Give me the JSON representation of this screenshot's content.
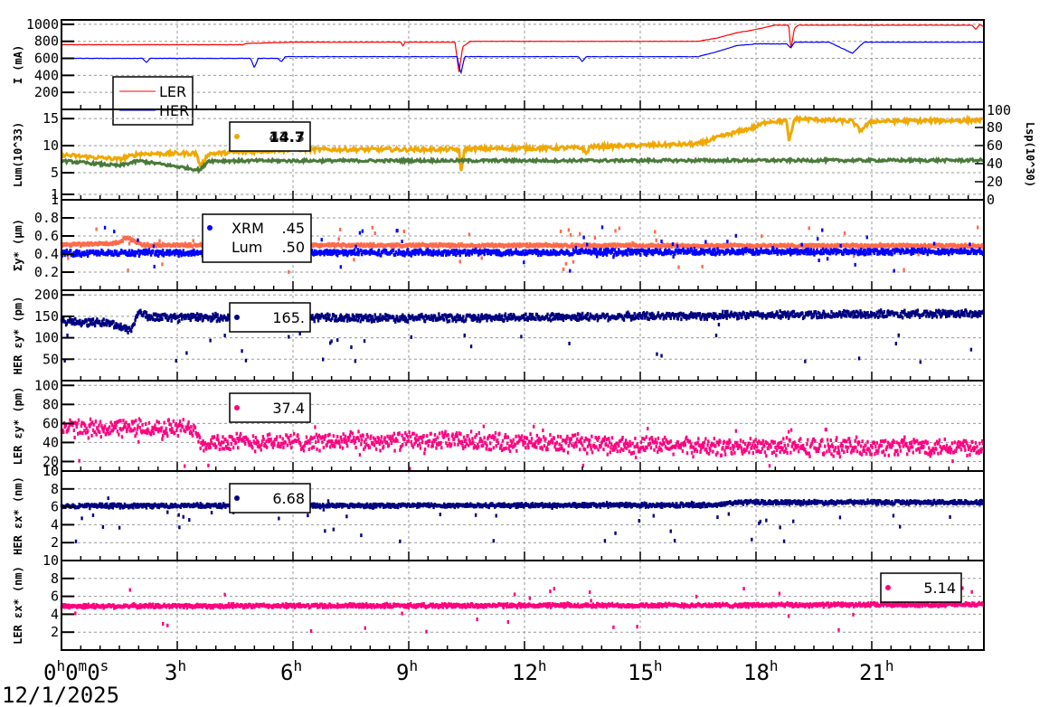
{
  "chart_data": [
    {
      "type": "line",
      "ylabel": "I (mA)",
      "ylim": [
        0,
        1052
      ],
      "yticks": [
        200,
        400,
        600,
        800,
        1000
      ],
      "legend_labels": [
        "LER",
        "HER"
      ],
      "series": [
        {
          "name": "LER",
          "color": "#ff0000",
          "noise": 2,
          "anchors": [
            [
              0,
              760
            ],
            [
              4.7,
              760
            ],
            [
              4.8,
              775
            ],
            [
              6,
              790
            ],
            [
              8.8,
              790
            ],
            [
              8.85,
              740
            ],
            [
              8.9,
              790
            ],
            [
              10.2,
              790
            ],
            [
              10.3,
              430
            ],
            [
              10.4,
              740
            ],
            [
              10.6,
              800
            ],
            [
              16.5,
              800
            ],
            [
              17,
              840
            ],
            [
              17.5,
              900
            ],
            [
              18,
              940
            ],
            [
              18.5,
              990
            ],
            [
              18.85,
              990
            ],
            [
              18.9,
              700
            ],
            [
              19,
              960
            ],
            [
              19.1,
              990
            ],
            [
              23.6,
              990
            ],
            [
              23.7,
              940
            ],
            [
              23.8,
              1000
            ],
            [
              23.9,
              970
            ]
          ]
        },
        {
          "name": "HER",
          "color": "#0000ff",
          "noise": 2,
          "anchors": [
            [
              0,
              600
            ],
            [
              2.1,
              600
            ],
            [
              2.2,
              550
            ],
            [
              2.3,
              600
            ],
            [
              4.9,
              600
            ],
            [
              5,
              490
            ],
            [
              5.1,
              600
            ],
            [
              5.6,
              600
            ],
            [
              5.7,
              560
            ],
            [
              5.8,
              620
            ],
            [
              10.25,
              620
            ],
            [
              10.35,
              420
            ],
            [
              10.45,
              620
            ],
            [
              13.4,
              620
            ],
            [
              13.5,
              560
            ],
            [
              13.6,
              620
            ],
            [
              16.5,
              620
            ],
            [
              17,
              680
            ],
            [
              17.5,
              750
            ],
            [
              18,
              770
            ],
            [
              18.8,
              770
            ],
            [
              18.9,
              720
            ],
            [
              19,
              790
            ],
            [
              19.9,
              790
            ],
            [
              20.5,
              660
            ],
            [
              20.8,
              790
            ],
            [
              23.9,
              790
            ]
          ]
        }
      ]
    },
    {
      "type": "line",
      "ylabel": "Lum(10^33)",
      "ylim": [
        0,
        16.7
      ],
      "yticks": [
        1,
        5,
        10,
        15
      ],
      "y2label": "Lsp(10^30)",
      "y2lim": [
        0,
        100
      ],
      "y2ticks": [
        0,
        20,
        40,
        60,
        80,
        100
      ],
      "legend_values": [
        "14.7",
        "43.3"
      ],
      "series": [
        {
          "name": "Lum",
          "color": "#f0a800",
          "noise": 0.35,
          "anchors": [
            [
              0,
              8.3
            ],
            [
              1.5,
              7.5
            ],
            [
              2,
              8.5
            ],
            [
              3.5,
              8.6
            ],
            [
              3.6,
              6
            ],
            [
              3.8,
              8.5
            ],
            [
              6,
              9.3
            ],
            [
              10.3,
              9.3
            ],
            [
              10.35,
              5
            ],
            [
              10.45,
              9.4
            ],
            [
              13.5,
              9.6
            ],
            [
              13.6,
              8.5
            ],
            [
              13.7,
              9.8
            ],
            [
              16.5,
              10.3
            ],
            [
              17,
              11.5
            ],
            [
              18,
              13.5
            ],
            [
              18.3,
              14.5
            ],
            [
              18.8,
              14.5
            ],
            [
              18.85,
              10.5
            ],
            [
              19,
              15
            ],
            [
              20.5,
              14.5
            ],
            [
              20.7,
              12.8
            ],
            [
              21,
              14.5
            ],
            [
              23.9,
              14.7
            ]
          ]
        },
        {
          "name": "Lsp",
          "color": "#4a7a3a",
          "noise": 0.25,
          "anchors": [
            [
              0,
              7.2
            ],
            [
              1.5,
              6.3
            ],
            [
              2,
              7.2
            ],
            [
              3.6,
              5.5
            ],
            [
              3.8,
              7.2
            ],
            [
              23.9,
              7.3
            ]
          ]
        }
      ]
    },
    {
      "type": "scatter",
      "ylabel": "Σy* (μm)",
      "ylim": [
        0,
        1
      ],
      "yticks": [
        0.2,
        0.4,
        0.6,
        0.8,
        1
      ],
      "legend_labels": [
        "XRM",
        ".45",
        "Lum",
        ".50"
      ],
      "series": [
        {
          "name": "Lum",
          "color": "#ff6a4a",
          "noise": 0.015,
          "anchors": [
            [
              0,
              0.5
            ],
            [
              1.4,
              0.52
            ],
            [
              1.7,
              0.58
            ],
            [
              2.1,
              0.5
            ],
            [
              23.9,
              0.49
            ]
          ]
        },
        {
          "name": "XRM",
          "color": "#0000ff",
          "noise": 0.03,
          "anchors": [
            [
              0,
              0.41
            ],
            [
              23.9,
              0.43
            ]
          ]
        }
      ]
    },
    {
      "type": "scatter",
      "ylabel": "HER εy* (pm)",
      "ylim": [
        0,
        211
      ],
      "yticks": [
        50,
        100,
        150,
        200
      ],
      "legend_values": [
        "165."
      ],
      "series": [
        {
          "name": "HER",
          "color": "#000080",
          "noise": 8,
          "anchors": [
            [
              0,
              138
            ],
            [
              1.2,
              135
            ],
            [
              1.8,
              118
            ],
            [
              2,
              160
            ],
            [
              2.3,
              148
            ],
            [
              10,
              146
            ],
            [
              17,
              152
            ],
            [
              23.9,
              157
            ]
          ]
        }
      ]
    },
    {
      "type": "scatter",
      "ylabel": "LER εy* (pm)",
      "ylim": [
        10,
        105
      ],
      "yticks": [
        10,
        20,
        40,
        60,
        80,
        100
      ],
      "legend_values": [
        "37.4"
      ],
      "series": [
        {
          "name": "LER",
          "color": "#ff0080",
          "noise": 9,
          "anchors": [
            [
              0,
              55
            ],
            [
              3.5,
              55
            ],
            [
              3.6,
              40
            ],
            [
              10.3,
              42
            ],
            [
              12,
              40
            ],
            [
              17,
              35
            ],
            [
              23.9,
              36
            ]
          ]
        }
      ]
    },
    {
      "type": "scatter",
      "ylabel": "HER εx* (nm)",
      "ylim": [
        0,
        10
      ],
      "yticks": [
        2,
        4,
        6,
        8,
        10
      ],
      "legend_values": [
        "6.68"
      ],
      "series": [
        {
          "name": "HER",
          "color": "#000080",
          "noise": 0.2,
          "anchors": [
            [
              0,
              6.1
            ],
            [
              17,
              6.2
            ],
            [
              17.5,
              6.5
            ],
            [
              23.9,
              6.5
            ]
          ]
        }
      ]
    },
    {
      "type": "scatter",
      "ylabel": "LER εx* (nm)",
      "ylim": [
        0,
        10
      ],
      "yticks": [
        2,
        4,
        6,
        8,
        10
      ],
      "legend_values": [
        "5.14"
      ],
      "series": [
        {
          "name": "LER",
          "color": "#ff0080",
          "noise": 0.2,
          "anchors": [
            [
              0,
              4.9
            ],
            [
              17,
              5.0
            ],
            [
              23.9,
              5.1
            ]
          ]
        }
      ]
    }
  ],
  "x_axis": {
    "xlim_hours": [
      0,
      23.9
    ],
    "ticks": [
      {
        "h": 0,
        "base": "0",
        "sup": "h",
        "extra": "0m0s"
      },
      {
        "h": 3,
        "base": "3",
        "sup": "h"
      },
      {
        "h": 6,
        "base": "6",
        "sup": "h"
      },
      {
        "h": 9,
        "base": "9",
        "sup": "h"
      },
      {
        "h": 12,
        "base": "12",
        "sup": "h"
      },
      {
        "h": 15,
        "base": "15",
        "sup": "h"
      },
      {
        "h": 18,
        "base": "18",
        "sup": "h"
      },
      {
        "h": 21,
        "base": "21",
        "sup": "h"
      }
    ],
    "date": "12/1/2025"
  }
}
